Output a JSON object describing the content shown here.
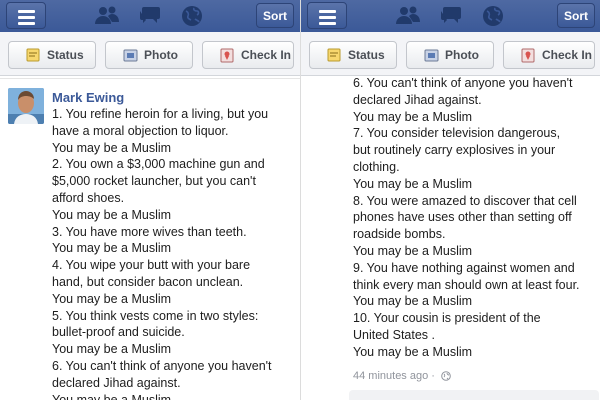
{
  "header": {
    "sort_label": "Sort"
  },
  "actions": {
    "status_label": "Status",
    "photo_label": "Photo",
    "checkin_label": "Check In"
  },
  "post": {
    "author": "Mark Ewing",
    "timestamp": "44 minutes ago",
    "lines": [
      "1. You refine heroin for a living, but you",
      "have a moral objection to liquor.",
      "You may be a Muslim",
      "2. You own a $3,000 machine gun and",
      "$5,000 rocket launcher, but you can't",
      "afford shoes.",
      "You may be a Muslim",
      "3. You have more wives than teeth.",
      "You may be a Muslim",
      "4. You wipe your butt with your bare",
      "hand, but consider bacon unclean.",
      "You may be a Muslim",
      "5. You think vests come in two styles:",
      "bullet-proof and suicide.",
      "You may be a Muslim",
      "6. You can't think of anyone you haven't",
      "declared Jihad against.",
      "You may be a Muslim",
      "7. You consider television dangerous,",
      "but routinely carry explosives in your",
      "clothing.",
      "You may be a Muslim",
      "8. You were amazed to discover that cell",
      "phones have uses other than setting off",
      "roadside bombs.",
      "You may be a Muslim",
      "9. You have nothing against women and",
      "think every man should own at least four.",
      "You may be a Muslim",
      "10. Your cousin is president of the",
      "United States .",
      "You may be a Muslim"
    ]
  },
  "colors": {
    "facebook_blue": "#3b5998",
    "text": "#1d1d1d",
    "meta": "#90949c"
  }
}
